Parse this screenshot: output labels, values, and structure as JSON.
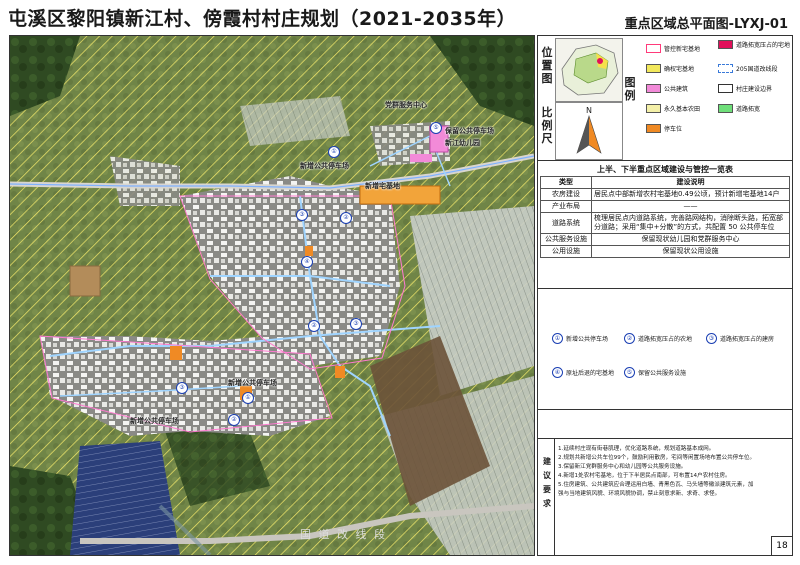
{
  "title": "屯溪区黎阳镇新江村、傍霞村村庄规划（2021-2035年）",
  "subtitle": "重点区域总平面图-LYXJ-01",
  "side_labels": {
    "location": "位置图",
    "scale": "比例尺",
    "legend": "图例"
  },
  "compass_north": "N",
  "legend": [
    {
      "label": "管控新宅基地",
      "color": "#ff6688"
    },
    {
      "label": "道路拓宽压占的宅地",
      "color": "#e0105a"
    },
    {
      "label": "确权宅基地",
      "color": "#f2e85c"
    },
    {
      "label": "205国道改线段",
      "color": "#ffffff"
    },
    {
      "label": "公共建筑",
      "color": "#f28ad8"
    },
    {
      "label": "村庄建设边界",
      "color": "#ffffff"
    },
    {
      "label": "永久基本农田",
      "color": "#f4f0a8"
    },
    {
      "label": "道路拓宽",
      "color": "#6fdf7a"
    },
    {
      "label": "停车位",
      "color": "#f08a24"
    }
  ],
  "table": {
    "title": "上半、下半重点区域建设与管控一览表",
    "headers": [
      "类型",
      "建设说明"
    ],
    "rows": [
      [
        "农房建设",
        "居民点中部新增农村宅基地0.49公顷，预计新增宅基地14户"
      ],
      [
        "产业布局",
        "——"
      ],
      [
        "道路系统",
        "梳理居民点内道路系统，完善路网结构，消除断头路，拓宽部分道路；采用“集中+分散”的方式，共配置 50 公共停车位"
      ],
      [
        "公共服务设施",
        "保留现状幼儿园和党群服务中心"
      ],
      [
        "公用设施",
        "保留现状公用设施"
      ]
    ]
  },
  "notes": [
    {
      "num": "①",
      "text": "新增公共停车场"
    },
    {
      "num": "②",
      "text": "道路拓宽压占的农地"
    },
    {
      "num": "③",
      "text": "道路拓宽压占的建房"
    },
    {
      "num": "④",
      "text": "原址后退的宅基地"
    },
    {
      "num": "⑤",
      "text": "保留公共服务设施"
    }
  ],
  "suggest_label": "建议要求",
  "suggestions": [
    "1.延续村庄现有街巷肌理，优化道路系统，规划道路基本成网。",
    "2.规划共新增公共车位99个，鼓励利用散房，宅间等闲置场地布置公共停车位。",
    "3.保留新江党群服务中心和幼儿园等公共服务设施。",
    "4.新增1处农村宅基地，位于下半居民点南部，可布置14户农村住房。",
    "5.住房建筑、公共建筑应合理运用白墙、青黑色瓦、马头墙等徽派建筑元素，加",
    "  强与当地建筑风貌、环境风貌协调，禁止刻意求新、求奇、求怪。"
  ],
  "page_number": "18",
  "map_labels": {
    "party_center": "党群服务中心",
    "parking_upper": "保留公共停车场",
    "kindergarten": "新江幼儿园",
    "new_parking_top": "新增公共停车场",
    "new_homestead": "新增宅基地",
    "new_parking_mid": "新增公共停车场",
    "new_parking_bot": "新增公共停车场",
    "road": "国 道 改 线 段"
  }
}
